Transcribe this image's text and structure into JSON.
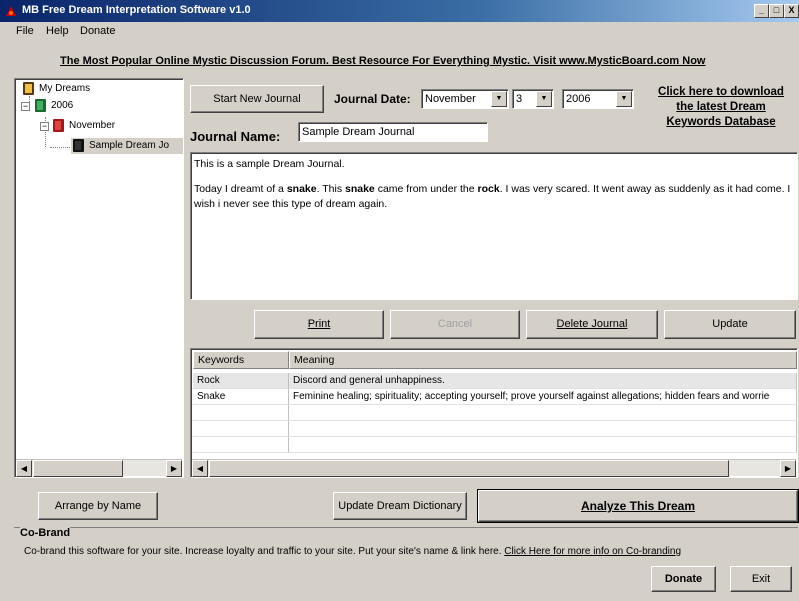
{
  "window": {
    "title": "MB Free Dream Interpretation Software v1.0",
    "controls": {
      "minimize": "_",
      "maximize": "□",
      "close": "X"
    }
  },
  "menu": {
    "items": [
      "File",
      "Help",
      "Donate"
    ]
  },
  "banner": "The Most Popular Online Mystic Discussion Forum. Best Resource For Everything Mystic. Visit www.MysticBoard.com Now",
  "tree": {
    "root": "My Dreams",
    "year": "2006",
    "month": "November",
    "journal": "Sample Dream Jo"
  },
  "toolbar": {
    "start_new_journal": "Start New Journal",
    "journal_date_label": "Journal Date:",
    "month_value": "November",
    "day_value": "3",
    "year_value": "2006",
    "download_link": "Click here to download the latest Dream Keywords Database"
  },
  "journal": {
    "name_label": "Journal Name:",
    "name_value": "Sample Dream Journal",
    "text_line1": "This is a sample Dream Journal.",
    "text_p2_a": "Today I dreamt of a ",
    "kw_snake_1": "snake",
    "text_p2_b": ". This ",
    "kw_snake_2": "snake",
    "text_p2_c": " came from under the ",
    "kw_rock": "rock",
    "text_p2_d": ". I was very scared. It went away as suddenly as it had come. I wish i never see this type of dream again."
  },
  "actions": {
    "print": "Print",
    "cancel": "Cancel",
    "delete_journal": "Delete Journal",
    "update": "Update"
  },
  "keywords_table": {
    "headers": [
      "Keywords",
      "Meaning"
    ],
    "rows": [
      {
        "keyword": "Rock",
        "meaning": "Discord and general unhappiness."
      },
      {
        "keyword": "Snake",
        "meaning": "Feminine healing; spirituality; accepting yourself; prove yourself against allegations; hidden fears and worrie"
      }
    ]
  },
  "bottom": {
    "arrange_by_name": "Arrange by Name",
    "update_dictionary": "Update Dream Dictionary",
    "analyze": "Analyze This Dream"
  },
  "cobrand": {
    "title": "Co-Brand",
    "text": "Co-brand this software for your site.  Increase loyalty and traffic to your site. Put your site's name & link here. ",
    "link": "Click Here for more info on Co-branding",
    "donate": "Donate",
    "exit": "Exit"
  },
  "colors": {
    "titlebar": "#0a246a",
    "face": "#d4d0c8"
  }
}
